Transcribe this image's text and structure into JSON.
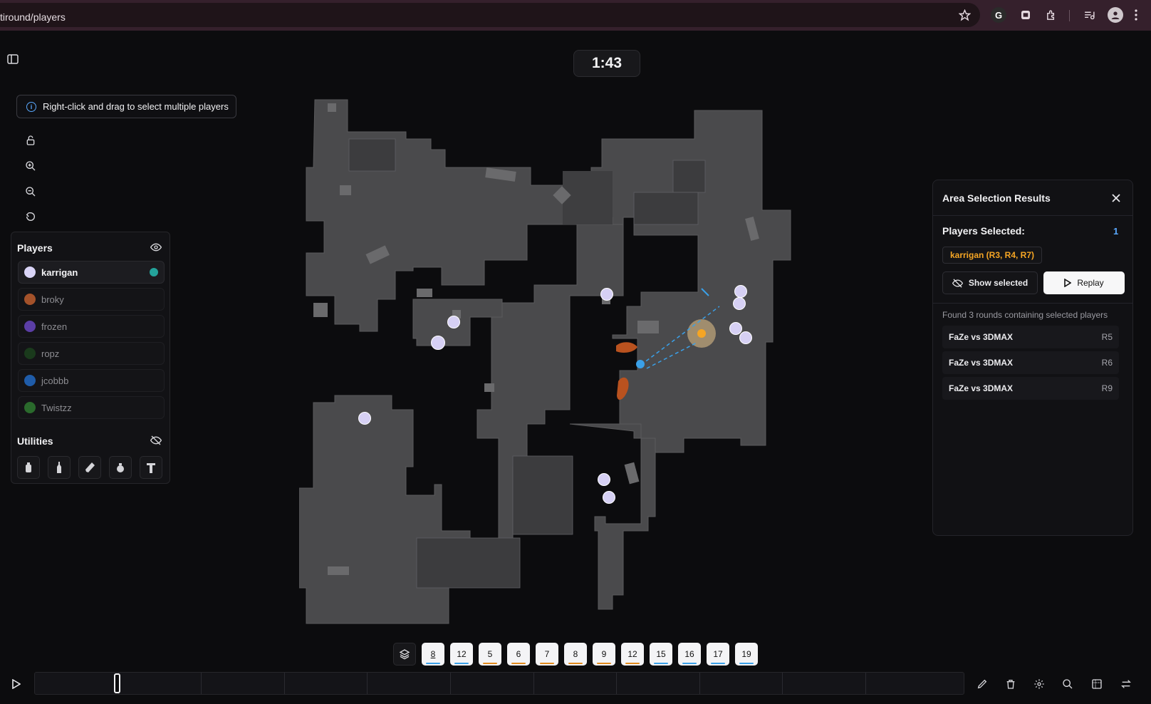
{
  "browser": {
    "url": "tiround/players"
  },
  "timer": "1:43",
  "hint": {
    "text": "Right-click and drag to select multiple players"
  },
  "players_panel": {
    "title": "Players",
    "players": [
      {
        "name": "karrigan",
        "color": "#d9d4f7",
        "active": true,
        "indicator_color": "#24a39b"
      },
      {
        "name": "broky",
        "color": "#a4522a",
        "active": false
      },
      {
        "name": "frozen",
        "color": "#5b3ea6",
        "active": false
      },
      {
        "name": "ropz",
        "color": "#1a3a1c",
        "active": false
      },
      {
        "name": "jcobbb",
        "color": "#1f5ca9",
        "active": false
      },
      {
        "name": "Twistzz",
        "color": "#2a6a2c",
        "active": false
      }
    ]
  },
  "utilities_panel": {
    "title": "Utilities",
    "items": [
      "smoke-grenade-icon",
      "molotov-icon",
      "flashbang-icon",
      "he-grenade-icon",
      "decoy-icon"
    ]
  },
  "area_results": {
    "title": "Area Selection Results",
    "players_selected_label": "Players Selected:",
    "players_selected_count": "1",
    "selected_tag": "karrigan (R3, R4, R7)",
    "show_selected_label": "Show selected",
    "replay_label": "Replay",
    "found_text": "Found 3 rounds containing selected players",
    "rounds": [
      {
        "match": "FaZe vs 3DMAX",
        "round": "R5"
      },
      {
        "match": "FaZe vs 3DMAX",
        "round": "R6"
      },
      {
        "match": "FaZe vs 3DMAX",
        "round": "R9"
      }
    ]
  },
  "round_chips": [
    {
      "label": "8",
      "bar": "#3aa0e8"
    },
    {
      "label": "12",
      "bar": "#3aa0e8"
    },
    {
      "label": "5",
      "bar": "#e08a1e"
    },
    {
      "label": "6",
      "bar": "#e08a1e"
    },
    {
      "label": "7",
      "bar": "#e08a1e"
    },
    {
      "label": "8",
      "bar": "#e08a1e"
    },
    {
      "label": "9",
      "bar": "#e08a1e"
    },
    {
      "label": "12",
      "bar": "#e08a1e"
    },
    {
      "label": "15",
      "bar": "#3aa0e8"
    },
    {
      "label": "16",
      "bar": "#3aa0e8"
    },
    {
      "label": "17",
      "bar": "#3aa0e8"
    },
    {
      "label": "19",
      "bar": "#3aa0e8"
    }
  ],
  "timeline": {
    "progress": 0.085
  },
  "colors": {
    "accent_orange": "#f5a524",
    "accent_blue": "#5aa9ff"
  }
}
